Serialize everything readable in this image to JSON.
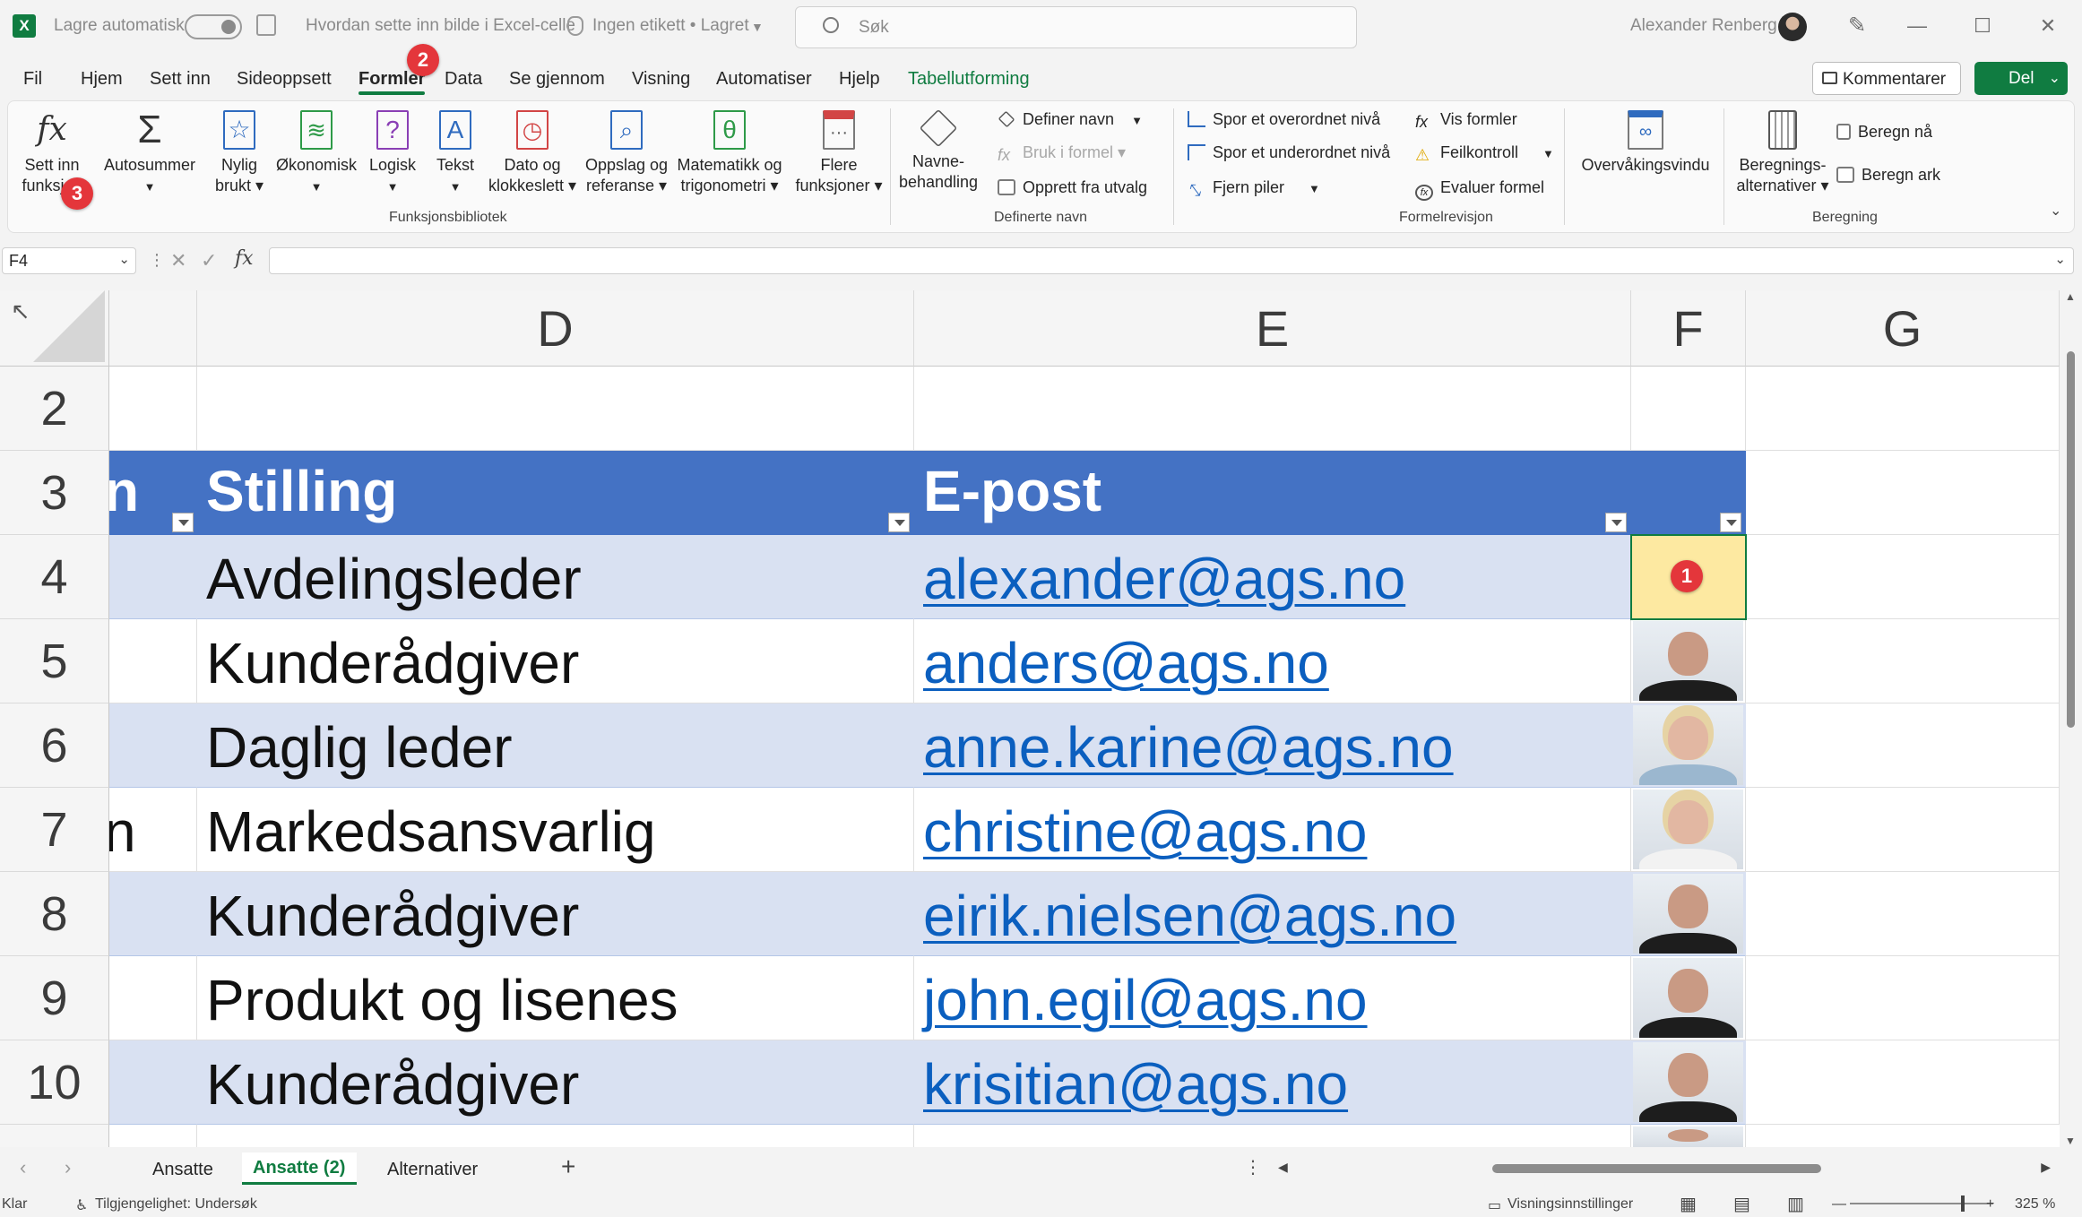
{
  "titlebar": {
    "app_icon": "excel-icon",
    "autosave_label": "Lagre automatisk",
    "doc_title": "Hvordan sette inn bilde i Excel-celle",
    "label_status": "Ingen etikett • Lagret",
    "search_placeholder": "Søk",
    "user_name": "Alexander Renberg"
  },
  "menu": {
    "tabs": [
      "Fil",
      "Hjem",
      "Sett inn",
      "Sideoppsett",
      "Formler",
      "Data",
      "Se gjennom",
      "Visning",
      "Automatiser",
      "Hjelp",
      "Tabellutforming"
    ],
    "active_tab": "Formler",
    "comment_button": "Kommentarer",
    "share_button": "Del"
  },
  "ribbon": {
    "insert_function": [
      "Sett inn",
      "funksjon"
    ],
    "autosum": "Autosummer",
    "recent": [
      "Nylig",
      "brukt"
    ],
    "financial": "Økonomisk",
    "logical": "Logisk",
    "text": "Tekst",
    "datetime": [
      "Dato og",
      "klokkeslett"
    ],
    "lookup": [
      "Oppslag og",
      "referanse"
    ],
    "math": [
      "Matematikk og",
      "trigonometri"
    ],
    "more": [
      "Flere",
      "funksjoner"
    ],
    "group_library": "Funksjonsbibliotek",
    "name_manager": [
      "Navne-",
      "behandling"
    ],
    "define_name": "Definer navn",
    "use_in_formula": "Bruk i formel",
    "create_from_selection": "Opprett fra utvalg",
    "group_names": "Definerte navn",
    "trace_precedents": "Spor et overordnet nivå",
    "trace_dependents": "Spor et underordnet nivå",
    "remove_arrows": "Fjern piler",
    "show_formulas": "Vis formler",
    "error_checking": "Feilkontroll",
    "evaluate_formula": "Evaluer formel",
    "watch_window": "Overvåkingsvindu",
    "group_auditing": "Formelrevisjon",
    "calc_options": [
      "Beregnings-",
      "alternativer"
    ],
    "calc_now": "Beregn nå",
    "calc_sheet": "Beregn ark",
    "group_calc": "Beregning"
  },
  "formula_bar": {
    "name_box": "F4",
    "fx_label": "fx",
    "content": ""
  },
  "badges": {
    "cell": "1",
    "formler": "2",
    "insert_fn": "3"
  },
  "grid": {
    "columns": [
      "D",
      "E",
      "F",
      "G"
    ],
    "rows": [
      "2",
      "3",
      "4",
      "5",
      "6",
      "7",
      "8",
      "9",
      "10"
    ],
    "header": {
      "c_fragment": "n",
      "stilling": "Stilling",
      "epost": "E-post"
    },
    "data": [
      {
        "c": "",
        "stilling": "Avdelingsleder",
        "epost": "alexander@ags.no"
      },
      {
        "c": "",
        "stilling": "Kunderådgiver",
        "epost": "anders@ags.no"
      },
      {
        "c": "",
        "stilling": "Daglig leder",
        "epost": "anne.karine@ags.no"
      },
      {
        "c": "n",
        "stilling": "Markedsansvarlig",
        "epost": "christine@ags.no"
      },
      {
        "c": "",
        "stilling": "Kunderådgiver",
        "epost": "eirik.nielsen@ags.no"
      },
      {
        "c": "",
        "stilling": "Produkt og lisenes",
        "epost": "john.egil@ags.no"
      },
      {
        "c": "",
        "stilling": "Kunderådgiver",
        "epost": "krisitian@ags.no"
      }
    ]
  },
  "sheets": {
    "tabs": [
      "Ansatte",
      "Ansatte (2)",
      "Alternativer"
    ],
    "active": "Ansatte (2)",
    "add": "+"
  },
  "status": {
    "ready": "Klar",
    "accessibility": "Tilgjengelighet: Undersøk",
    "view_settings": "Visningsinnstillinger",
    "zoom": "325 %"
  },
  "colors": {
    "accent": "#107c41",
    "table_header": "#4472c4",
    "band": "#d9e1f2",
    "selected": "#fde9a1",
    "badge": "#e4363b"
  }
}
